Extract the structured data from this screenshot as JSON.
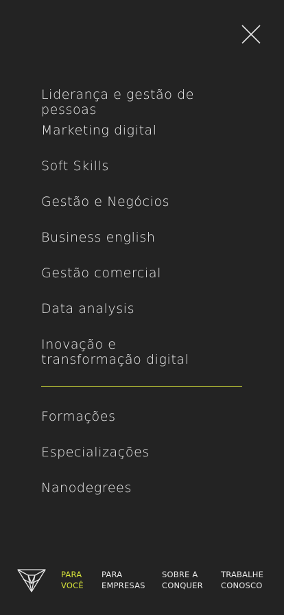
{
  "close": {
    "icon": "close-icon"
  },
  "menu": {
    "items": [
      {
        "label": "Liderança e gestão de pessoas"
      },
      {
        "label": "Marketing digital"
      },
      {
        "label": "Soft Skills"
      },
      {
        "label": "Gestão e Negócios"
      },
      {
        "label": "Business english"
      },
      {
        "label": "Gestão comercial"
      },
      {
        "label": "Data analysis"
      },
      {
        "label": "Inovação e transformação digital"
      }
    ]
  },
  "secondary_menu": {
    "items": [
      {
        "label": "Formações"
      },
      {
        "label": "Especializações"
      },
      {
        "label": "Nanodegrees"
      }
    ]
  },
  "bottom_nav": {
    "logo_icon": "conquer-logo-icon",
    "links": [
      {
        "line1": "PARA",
        "line2": "VOCÊ",
        "active": true
      },
      {
        "line1": "PARA",
        "line2": "EMPRESAS",
        "active": false
      },
      {
        "line1": "SOBRE A",
        "line2": "CONQUER",
        "active": false
      },
      {
        "line1": "TRABALHE",
        "line2": "CONOSCO",
        "active": false
      }
    ]
  },
  "colors": {
    "background": "#232323",
    "text": "#ececec",
    "accent": "#d7e43a"
  }
}
